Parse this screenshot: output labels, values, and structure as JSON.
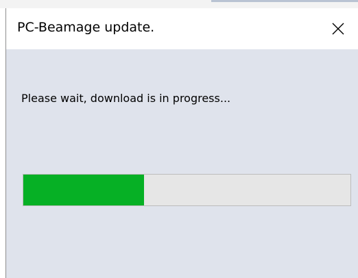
{
  "dialog": {
    "title": "PC-Beamage update.",
    "message": "Please wait, download is in progress...",
    "progress": 0.37,
    "progress_color": "#06b025",
    "close_icon": "close-icon"
  }
}
